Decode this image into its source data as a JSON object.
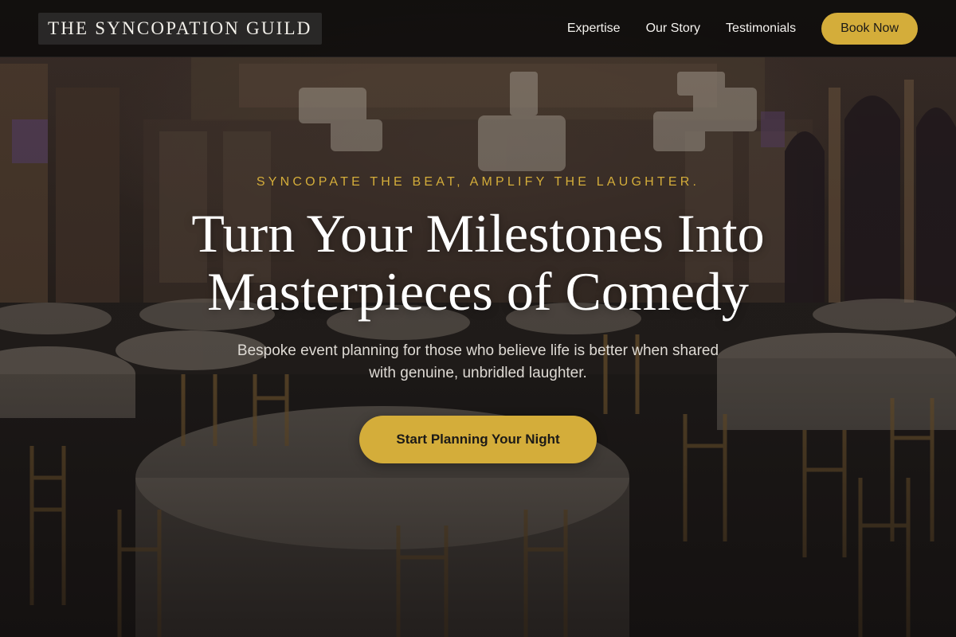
{
  "brand": {
    "name": "THE SYNCOPATION GUILD"
  },
  "nav": {
    "links": [
      {
        "label": "Expertise"
      },
      {
        "label": "Our Story"
      },
      {
        "label": "Testimonials"
      }
    ],
    "cta_label": "Book Now"
  },
  "hero": {
    "tagline": "Syncopate the beat, amplify the laughter.",
    "headline_line1": "Turn Your Milestones Into",
    "headline_line2": "Masterpieces of Comedy",
    "subtext": "Bespoke event planning for those who believe life is better when shared with genuine, unbridled laughter.",
    "cta_label": "Start Planning Your Night",
    "background_description_icon": "ballroom-image"
  },
  "colors": {
    "accent": "#d4ad3a",
    "navbar_bg": "#080808",
    "text_primary": "#ffffff",
    "text_secondary": "#dedad4"
  }
}
